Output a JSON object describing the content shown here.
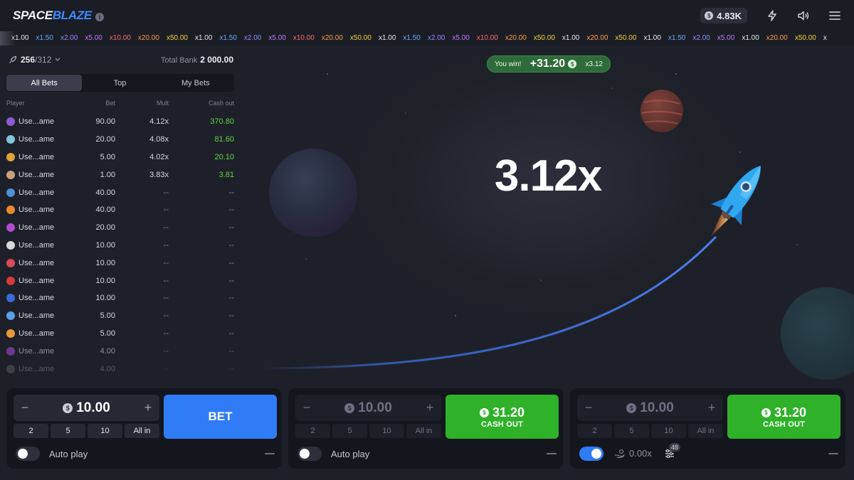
{
  "header": {
    "logo_part1": "SPACE",
    "logo_part2": "BLAZE",
    "info_symbol": "i",
    "currency_symbol": "$",
    "balance": "4.83K",
    "icons": [
      "lightning-icon",
      "sound-icon",
      "menu-icon"
    ]
  },
  "history": [
    {
      "v": "x1.00",
      "c": "#e6e8ef"
    },
    {
      "v": "x1.50",
      "c": "#6aa8ff"
    },
    {
      "v": "x2.00",
      "c": "#8b8cff"
    },
    {
      "v": "x5.00",
      "c": "#c07bff"
    },
    {
      "v": "x10.00",
      "c": "#ff6a6a"
    },
    {
      "v": "x20.00",
      "c": "#ff9a4a"
    },
    {
      "v": "x50.00",
      "c": "#f1d33d"
    },
    {
      "v": "x1.00",
      "c": "#e6e8ef"
    },
    {
      "v": "x1.50",
      "c": "#6aa8ff"
    },
    {
      "v": "x2.00",
      "c": "#8b8cff"
    },
    {
      "v": "x5.00",
      "c": "#c07bff"
    },
    {
      "v": "x10.00",
      "c": "#ff6a6a"
    },
    {
      "v": "x20.00",
      "c": "#ff9a4a"
    },
    {
      "v": "x50.00",
      "c": "#f1d33d"
    },
    {
      "v": "x1.00",
      "c": "#e6e8ef"
    },
    {
      "v": "x1.50",
      "c": "#6aa8ff"
    },
    {
      "v": "x2.00",
      "c": "#8b8cff"
    },
    {
      "v": "x5.00",
      "c": "#c07bff"
    },
    {
      "v": "x10.00",
      "c": "#ff6a6a"
    },
    {
      "v": "x20.00",
      "c": "#ff9a4a"
    },
    {
      "v": "x50.00",
      "c": "#f1d33d"
    },
    {
      "v": "x1.00",
      "c": "#e6e8ef"
    },
    {
      "v": "x20.00",
      "c": "#ff9a4a"
    },
    {
      "v": "x50.00",
      "c": "#f1d33d"
    },
    {
      "v": "x1.00",
      "c": "#e6e8ef"
    },
    {
      "v": "x1.50",
      "c": "#6aa8ff"
    },
    {
      "v": "x2.00",
      "c": "#8b8cff"
    },
    {
      "v": "x5.00",
      "c": "#c07bff"
    },
    {
      "v": "x1.00",
      "c": "#e6e8ef"
    },
    {
      "v": "x20.00",
      "c": "#ff9a4a"
    },
    {
      "v": "x50.00",
      "c": "#f1d33d"
    },
    {
      "v": "x",
      "c": "#e6e8ef"
    }
  ],
  "stats": {
    "players_current": "256",
    "players_total": "/312",
    "bank_label": "Total Bank",
    "bank_value": "2 000.00"
  },
  "tabs": [
    "All Bets",
    "Top",
    "My Bets"
  ],
  "columns": {
    "player": "Player",
    "bet": "Bet",
    "mult": "Mult",
    "cashout": "Cash out"
  },
  "bets": [
    {
      "player": "Use...ame",
      "bet": "90.00",
      "mult": "4.12x",
      "cashout": "370.80",
      "avatar": "#8e5bd6",
      "won": true
    },
    {
      "player": "Use...ame",
      "bet": "20.00",
      "mult": "4.08x",
      "cashout": "81.60",
      "avatar": "#7fc7d9",
      "won": true
    },
    {
      "player": "Use...ame",
      "bet": "5.00",
      "mult": "4.02x",
      "cashout": "20.10",
      "avatar": "#e0a23a",
      "won": true
    },
    {
      "player": "Use...ame",
      "bet": "1.00",
      "mult": "3.83x",
      "cashout": "3.81",
      "avatar": "#caa07a",
      "won": true
    },
    {
      "player": "Use...ame",
      "bet": "40.00",
      "mult": "--",
      "cashout": "--",
      "avatar": "#4f8fd8",
      "won": false
    },
    {
      "player": "Use...ame",
      "bet": "40.00",
      "mult": "--",
      "cashout": "--",
      "avatar": "#e88a2d",
      "won": false
    },
    {
      "player": "Use...ame",
      "bet": "20.00",
      "mult": "--",
      "cashout": "--",
      "avatar": "#b04ad0",
      "won": false
    },
    {
      "player": "Use...ame",
      "bet": "10.00",
      "mult": "--",
      "cashout": "--",
      "avatar": "#d8d8d8",
      "won": false
    },
    {
      "player": "Use...ame",
      "bet": "10.00",
      "mult": "--",
      "cashout": "--",
      "avatar": "#d84a5a",
      "won": false
    },
    {
      "player": "Use...ame",
      "bet": "10.00",
      "mult": "--",
      "cashout": "--",
      "avatar": "#d83a3a",
      "won": false
    },
    {
      "player": "Use...ame",
      "bet": "10.00",
      "mult": "--",
      "cashout": "--",
      "avatar": "#3a6ad8",
      "won": false
    },
    {
      "player": "Use...ame",
      "bet": "5.00",
      "mult": "--",
      "cashout": "--",
      "avatar": "#5aa0e8",
      "won": false
    },
    {
      "player": "Use...ame",
      "bet": "5.00",
      "mult": "--",
      "cashout": "--",
      "avatar": "#e89a3a",
      "won": false
    },
    {
      "player": "Use...ame",
      "bet": "4.00",
      "mult": "--",
      "cashout": "--",
      "avatar": "#a04ad0",
      "won": false
    },
    {
      "player": "Use...ame",
      "bet": "4.00",
      "mult": "--",
      "cashout": "--",
      "avatar": "#8a8a8a",
      "won": false
    }
  ],
  "game": {
    "win_label": "You win!",
    "win_amount": "+31.20",
    "win_mult": "x3.12",
    "multiplier": "3.12x"
  },
  "panels": [
    {
      "amount": "10.00",
      "quick": [
        "2",
        "5",
        "10",
        "All in"
      ],
      "action": "BET",
      "auto_label": "Auto play",
      "auto_on": false
    },
    {
      "amount": "10.00",
      "quick": [
        "2",
        "5",
        "10",
        "All in"
      ],
      "cash_amount": "31.20",
      "cash_label": "CASH OUT",
      "auto_label": "Auto play",
      "auto_on": false
    },
    {
      "amount": "10.00",
      "quick": [
        "2",
        "5",
        "10",
        "All in"
      ],
      "cash_amount": "31.20",
      "cash_label": "CASH OUT",
      "auto_on": true,
      "auto_mult": "0.00x",
      "auto_rounds": "48"
    }
  ],
  "colors": {
    "accent_blue": "#2f7cf6",
    "cash_green": "#2fb12a",
    "win_text": "#63d44a"
  }
}
